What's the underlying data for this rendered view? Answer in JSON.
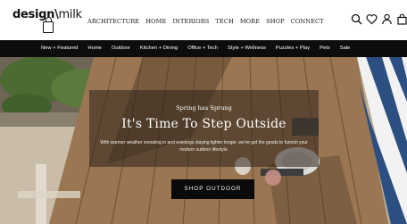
{
  "brand": {
    "logo_text": "design",
    "logo_text_suffix": "milk"
  },
  "main_nav": {
    "items": [
      "ARCHITECTURE",
      "HOME",
      "INTERIORS",
      "TECH",
      "MORE",
      "SHOP",
      "CONNECT"
    ]
  },
  "header_icons": [
    "search-icon",
    "heart-icon",
    "user-icon",
    "bag-icon"
  ],
  "category_nav": {
    "items": [
      "New + Featured",
      "Home",
      "Outdoor",
      "Kitchen + Dining",
      "Office + Tech",
      "Style + Wellness",
      "Puzzles + Play",
      "Pets",
      "Sale"
    ]
  },
  "hero": {
    "kicker": "Spring has Sprung",
    "headline": "It's Time To Step Outside",
    "description": "With warmer weather sneaking in and evenings staying lighter longer, we've got the goods to furnish your modern outdoor lifestyle.",
    "cta_label": "SHOP OUTDOOR"
  },
  "colors": {
    "header_bg": "#ffffff",
    "category_bar_bg": "#0d0d0d",
    "cta_bg": "#0a0a0a",
    "overlay": "rgba(45,35,25,0.55)"
  }
}
